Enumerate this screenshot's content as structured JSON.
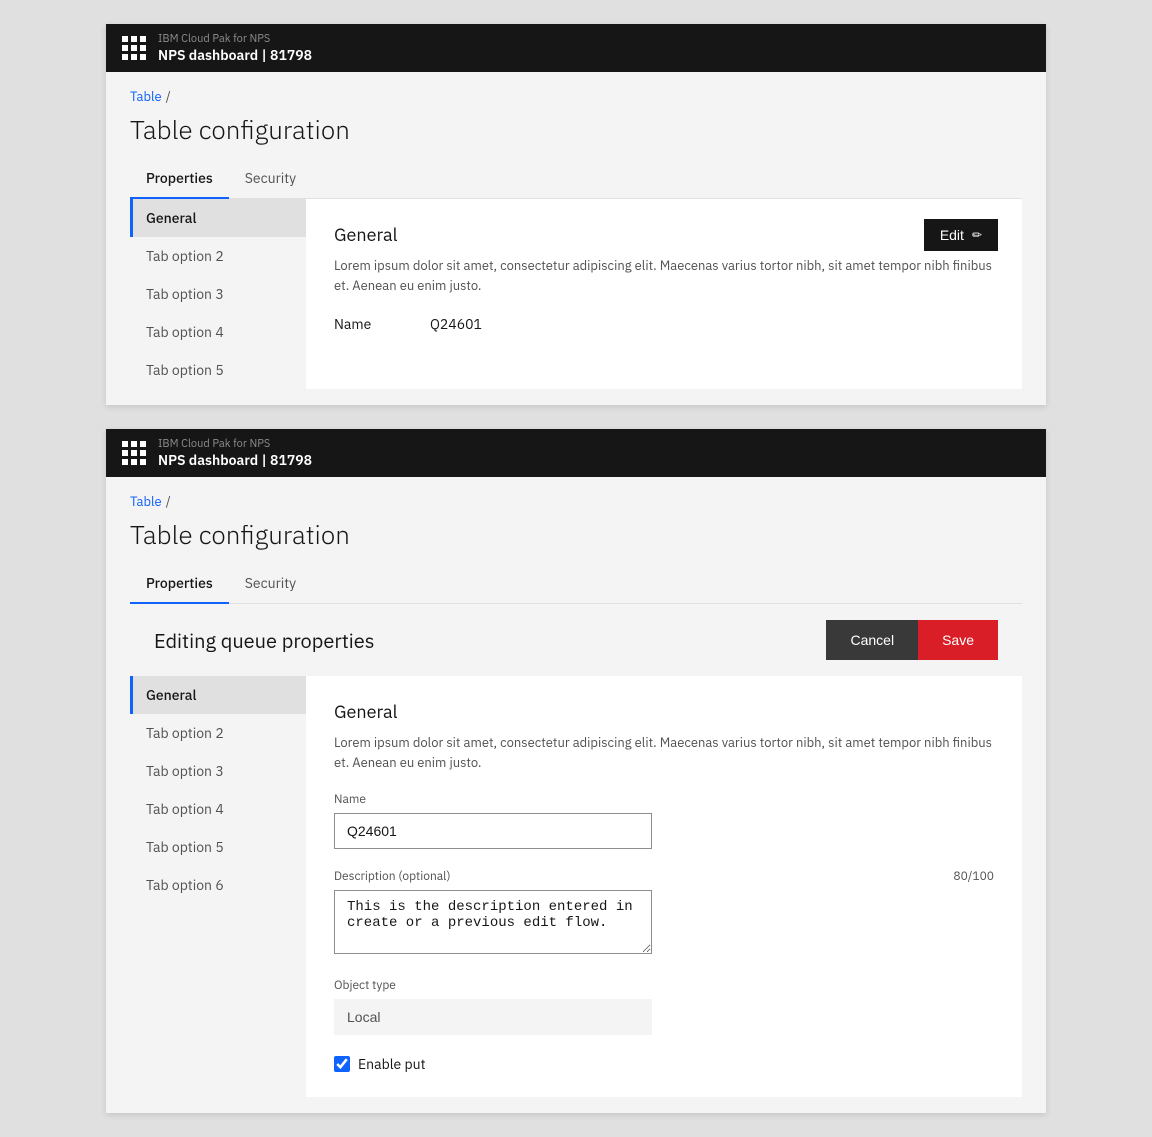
{
  "app": {
    "subtitle": "IBM Cloud Pak for NPS",
    "title": "NPS dashboard | 81798"
  },
  "breadcrumb": {
    "link": "Table",
    "separator": "/"
  },
  "page": {
    "title": "Table configuration"
  },
  "tabs": [
    {
      "label": "Properties",
      "active": true
    },
    {
      "label": "Security",
      "active": false
    }
  ],
  "panel1": {
    "sidebar_items": [
      {
        "label": "General",
        "active": true
      },
      {
        "label": "Tab option 2",
        "active": false
      },
      {
        "label": "Tab option 3",
        "active": false
      },
      {
        "label": "Tab option 4",
        "active": false
      },
      {
        "label": "Tab option 5",
        "active": false
      }
    ],
    "section": {
      "title": "General",
      "description": "Lorem ipsum dolor sit amet, consectetur adipiscing elit. Maecenas varius tortor nibh, sit amet tempor nibh finibus et. Aenean eu enim justo.",
      "field_label": "Name",
      "field_value": "Q24601"
    },
    "edit_button": "Edit",
    "edit_icon": "✏"
  },
  "panel2": {
    "editing_title": "Editing queue properties",
    "cancel_label": "Cancel",
    "save_label": "Save",
    "sidebar_items": [
      {
        "label": "General",
        "active": true
      },
      {
        "label": "Tab option 2",
        "active": false
      },
      {
        "label": "Tab option 3",
        "active": false
      },
      {
        "label": "Tab option 4",
        "active": false
      },
      {
        "label": "Tab option 5",
        "active": false
      },
      {
        "label": "Tab option 6",
        "active": false
      }
    ],
    "section": {
      "title": "General",
      "description": "Lorem ipsum dolor sit amet, consectetur adipiscing elit. Maecenas varius tortor nibh, sit amet tempor nibh finibus et. Aenean eu enim justo.",
      "name_label": "Name",
      "name_value": "Q24601",
      "description_label": "Description (optional)",
      "description_counter": "80/100",
      "description_value": "This is the description entered in create or a previous edit flow.",
      "object_type_label": "Object type",
      "object_type_value": "Local",
      "checkbox_label": "Enable put",
      "checkbox_checked": true
    }
  },
  "icons": {
    "grid": "⊞",
    "edit": "✏"
  }
}
